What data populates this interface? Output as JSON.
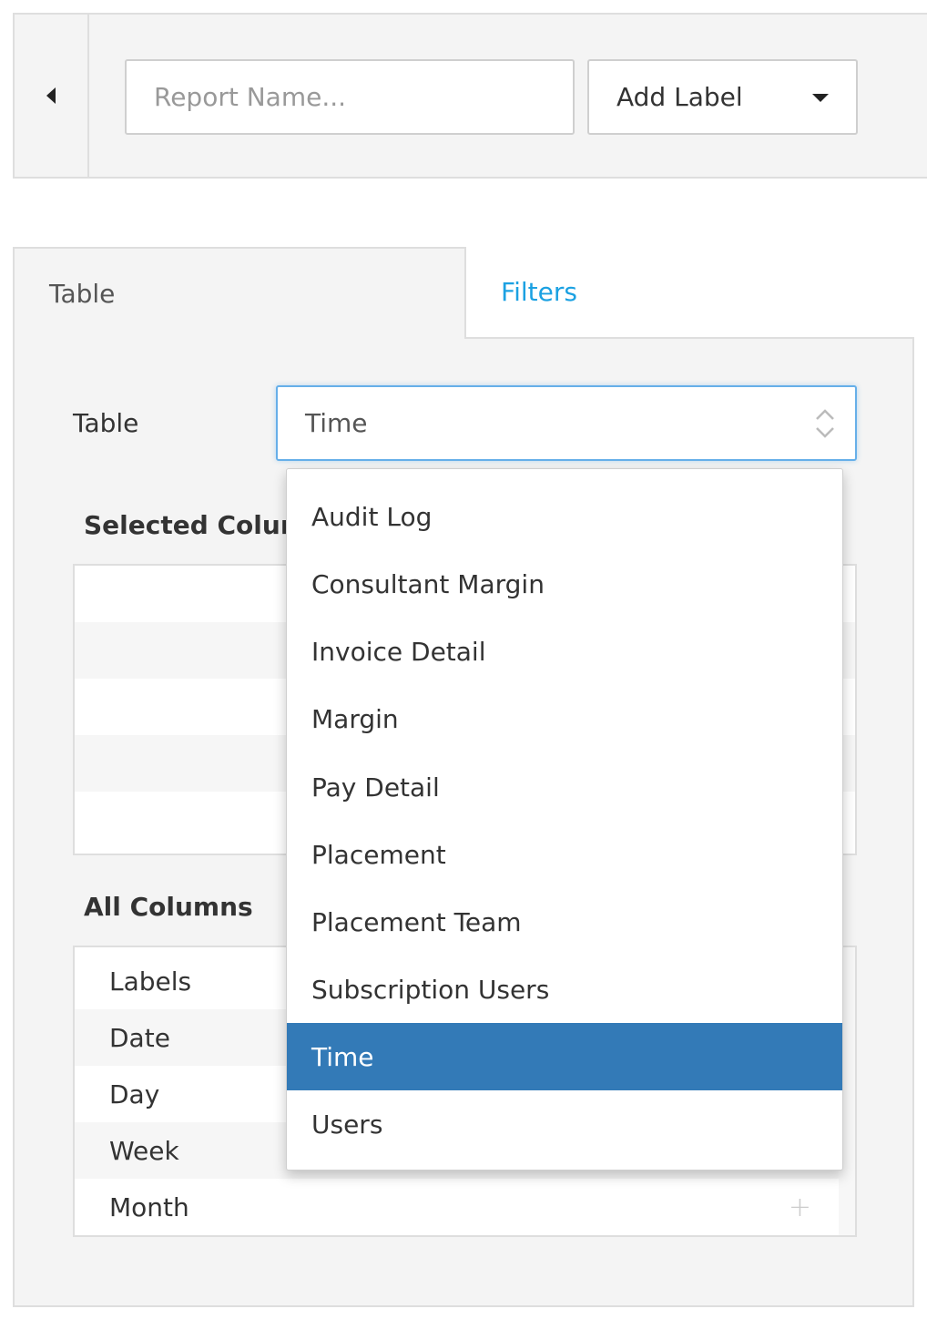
{
  "header": {
    "report_name_placeholder": "Report Name...",
    "add_label": "Add Label"
  },
  "tabs": [
    {
      "label": "Table",
      "active": true
    },
    {
      "label": "Filters",
      "active": false
    }
  ],
  "table_field": {
    "label": "Table",
    "value": "Time"
  },
  "selected_columns": {
    "title": "Selected Columns"
  },
  "all_columns": {
    "title": "All Columns",
    "items": [
      "Labels",
      "Date",
      "Day",
      "Week",
      "Month"
    ]
  },
  "dropdown": {
    "options": [
      "Audit Log",
      "Consultant Margin",
      "Invoice Detail",
      "Margin",
      "Pay Detail",
      "Placement",
      "Placement Team",
      "Subscription Users",
      "Time",
      "Users"
    ],
    "selected": "Time"
  },
  "colors": {
    "accent_link": "#1ba1e2",
    "selected_option": "#337ab7",
    "focus_border": "#66afe9"
  }
}
